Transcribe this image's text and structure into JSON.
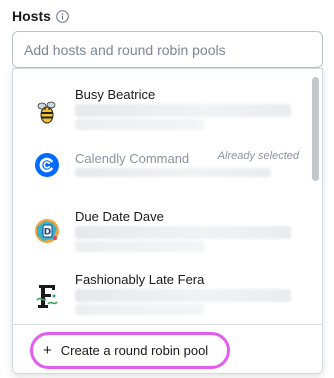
{
  "hosts": {
    "label": "Hosts",
    "info_icon": "info-icon",
    "search_placeholder": "Add hosts and round robin pools"
  },
  "list": {
    "items": [
      {
        "name": "Busy Beatrice",
        "avatar": "bee-avatar-icon",
        "status": ""
      },
      {
        "name": "Calendly Command",
        "avatar": "calendly-logo-icon",
        "status": "Already selected"
      },
      {
        "name": "Due Date Dave",
        "avatar": "dave-avatar-icon",
        "status": ""
      },
      {
        "name": "Fashionably Late Fera",
        "avatar": "fera-avatar-icon",
        "status": ""
      }
    ]
  },
  "footer": {
    "plus_icon": "plus-icon",
    "create_label": "Create a round robin pool"
  },
  "colors": {
    "highlight_ring": "#e45bf0",
    "calendly_blue": "#006bff",
    "text_muted": "#8a94a0"
  }
}
